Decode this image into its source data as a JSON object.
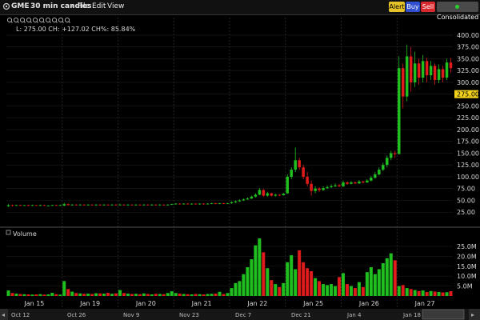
{
  "toolbar": {
    "symbol": "GME",
    "interval": "30 min candles",
    "menu_items": [
      "File",
      "Edit",
      "View"
    ],
    "buttons": {
      "alert": {
        "label": "Alert",
        "color": "#e6c229"
      },
      "buy": {
        "label": "Buy",
        "color": "#2f4fd0"
      },
      "sell": {
        "label": "Sell",
        "color": "#d9292e"
      },
      "consolidated": {
        "label": "Consolidated",
        "color": "#4a4a4a"
      }
    }
  },
  "price_panel": {
    "readout": "L: 275.00  CH: +127.02  CH%: 85.84%",
    "y_ticks": [
      "400.00",
      "375.00",
      "350.00",
      "325.00",
      "300.00",
      "275.00",
      "250.00",
      "225.00",
      "200.00",
      "175.00",
      "150.00",
      "125.00",
      "100.00",
      "75.00",
      "50.00",
      "25.00"
    ],
    "last_price_label": "275.00",
    "last_price_color": "#f2d21b"
  },
  "volume_panel": {
    "title": "Volume",
    "y_ticks": [
      "25.0M",
      "20.0M",
      "15.0M",
      "10.0M",
      "5.0M"
    ]
  },
  "x_axis": {
    "labels": [
      "Jan 15",
      "Jan 19",
      "Jan 20",
      "Jan 21",
      "Jan 22",
      "Jan 25",
      "Jan 26",
      "Jan 27"
    ]
  },
  "overview_axis": {
    "labels": [
      "Oct 12",
      "Oct 26",
      "Nov 9",
      "Nov 23",
      "Dec 7",
      "Dec 21",
      "Jan 4",
      "Jan 18"
    ]
  },
  "colors": {
    "up": "#1fbf1f",
    "down": "#e01b1b",
    "grid": "#2e2e2e",
    "background": "#000000"
  },
  "chart_data": {
    "type": "candlestick",
    "ylim": [
      0,
      410
    ],
    "volume_ylim": [
      0,
      29
    ],
    "days": [
      {
        "label": "Jan 15",
        "candles": [
          [
            38,
            40,
            42,
            36,
            2.8
          ],
          [
            40,
            39,
            41,
            37,
            1.5
          ],
          [
            39,
            40,
            41,
            38,
            1.2
          ],
          [
            40,
            39,
            41,
            38,
            1.0
          ],
          [
            39,
            40,
            40,
            38,
            0.9
          ],
          [
            40,
            39,
            41,
            38,
            0.8
          ],
          [
            39,
            40,
            41,
            38,
            0.7
          ],
          [
            40,
            39,
            40,
            38,
            0.8
          ],
          [
            39,
            40,
            41,
            38,
            0.9
          ],
          [
            40,
            39,
            41,
            38,
            0.7
          ],
          [
            39,
            39,
            40,
            38,
            0.8
          ],
          [
            39,
            40,
            41,
            38,
            1.6
          ],
          [
            40,
            39,
            41,
            38,
            0.9
          ],
          [
            39,
            40,
            41,
            38,
            0.7
          ]
        ]
      },
      {
        "label": "Jan 19",
        "candles": [
          [
            39,
            42,
            45,
            38,
            7.5
          ],
          [
            42,
            40,
            43,
            39,
            3.5
          ],
          [
            40,
            41,
            42,
            39,
            2.2
          ],
          [
            41,
            40,
            42,
            39,
            1.5
          ],
          [
            40,
            41,
            42,
            39,
            1.3
          ],
          [
            41,
            40,
            42,
            39,
            1.1
          ],
          [
            40,
            41,
            42,
            39,
            1.2
          ],
          [
            41,
            40,
            42,
            39,
            1.0
          ],
          [
            40,
            41,
            42,
            39,
            1.4
          ],
          [
            41,
            40,
            42,
            39,
            1.3
          ],
          [
            40,
            41,
            42,
            39,
            1.2
          ],
          [
            41,
            40,
            42,
            39,
            1.6
          ],
          [
            40,
            41,
            42,
            39,
            1.1
          ],
          [
            41,
            40,
            42,
            39,
            1.3
          ]
        ]
      },
      {
        "label": "Jan 20",
        "candles": [
          [
            40,
            41,
            43,
            39,
            3.0
          ],
          [
            41,
            40,
            42,
            39,
            1.5
          ],
          [
            40,
            41,
            42,
            39,
            1.2
          ],
          [
            41,
            40,
            42,
            39,
            1.0
          ],
          [
            40,
            41,
            42,
            39,
            1.1
          ],
          [
            41,
            40,
            42,
            39,
            0.9
          ],
          [
            40,
            41,
            42,
            39,
            1.3
          ],
          [
            41,
            40,
            42,
            39,
            1.0
          ],
          [
            40,
            41,
            42,
            39,
            0.8
          ],
          [
            41,
            40,
            42,
            39,
            1.1
          ],
          [
            40,
            41,
            42,
            39,
            1.0
          ],
          [
            41,
            40,
            42,
            39,
            0.9
          ],
          [
            40,
            41,
            42,
            39,
            1.5
          ],
          [
            41,
            42,
            43,
            40,
            2.4
          ]
        ]
      },
      {
        "label": "Jan 21",
        "candles": [
          [
            42,
            43,
            44,
            41,
            1.5
          ],
          [
            43,
            42,
            44,
            41,
            1.2
          ],
          [
            42,
            43,
            44,
            41,
            1.0
          ],
          [
            43,
            42,
            44,
            41,
            0.9
          ],
          [
            42,
            43,
            44,
            41,
            0.8
          ],
          [
            43,
            42,
            44,
            41,
            1.0
          ],
          [
            42,
            43,
            44,
            41,
            0.9
          ],
          [
            43,
            42,
            44,
            41,
            0.8
          ],
          [
            42,
            43,
            44,
            41,
            1.0
          ],
          [
            43,
            44,
            45,
            42,
            1.1
          ],
          [
            44,
            43,
            45,
            42,
            1.2
          ],
          [
            43,
            44,
            45,
            42,
            2.1
          ],
          [
            44,
            43,
            45,
            42,
            1.0
          ],
          [
            43,
            44,
            45,
            42,
            1.5
          ]
        ]
      },
      {
        "label": "Jan 22",
        "candles": [
          [
            44,
            46,
            48,
            43,
            4.0
          ],
          [
            46,
            48,
            50,
            45,
            6.5
          ],
          [
            48,
            50,
            52,
            47,
            7.5
          ],
          [
            50,
            52,
            54,
            49,
            11.0
          ],
          [
            52,
            54,
            56,
            51,
            14.5
          ],
          [
            54,
            58,
            60,
            53,
            18.5
          ],
          [
            58,
            62,
            65,
            56,
            25.5
          ],
          [
            62,
            72,
            76,
            61,
            29.0
          ],
          [
            72,
            60,
            74,
            58,
            22.0
          ],
          [
            60,
            65,
            68,
            58,
            14.0
          ],
          [
            65,
            60,
            66,
            58,
            8.0
          ],
          [
            60,
            62,
            64,
            58,
            6.0
          ],
          [
            62,
            61,
            63,
            59,
            4.5
          ],
          [
            61,
            64,
            66,
            60,
            6.5
          ]
        ]
      },
      {
        "label": "Jan 25",
        "candles": [
          [
            65,
            100,
            105,
            64,
            17.0
          ],
          [
            100,
            115,
            120,
            95,
            20.5
          ],
          [
            115,
            135,
            162,
            110,
            13.5
          ],
          [
            135,
            120,
            140,
            115,
            23.0
          ],
          [
            120,
            100,
            125,
            95,
            17.0
          ],
          [
            100,
            85,
            110,
            80,
            14.0
          ],
          [
            85,
            70,
            92,
            60,
            12.5
          ],
          [
            70,
            75,
            80,
            65,
            9.0
          ],
          [
            75,
            72,
            78,
            68,
            7.5
          ],
          [
            72,
            76,
            80,
            70,
            6.0
          ],
          [
            76,
            78,
            82,
            74,
            5.5
          ],
          [
            78,
            80,
            84,
            76,
            6.0
          ],
          [
            80,
            82,
            86,
            78,
            5.0
          ],
          [
            82,
            80,
            85,
            78,
            9.5
          ]
        ]
      },
      {
        "label": "Jan 26",
        "candles": [
          [
            80,
            88,
            92,
            78,
            11.5
          ],
          [
            88,
            85,
            90,
            83,
            6.0
          ],
          [
            85,
            88,
            91,
            84,
            5.0
          ],
          [
            88,
            86,
            90,
            84,
            4.0
          ],
          [
            86,
            90,
            93,
            85,
            7.0
          ],
          [
            90,
            88,
            92,
            86,
            4.5
          ],
          [
            88,
            92,
            95,
            87,
            12.0
          ],
          [
            92,
            98,
            102,
            90,
            14.5
          ],
          [
            98,
            105,
            110,
            96,
            11.0
          ],
          [
            105,
            115,
            120,
            103,
            13.5
          ],
          [
            115,
            125,
            130,
            112,
            16.5
          ],
          [
            125,
            140,
            145,
            120,
            19.0
          ],
          [
            140,
            150,
            155,
            135,
            21.5
          ],
          [
            150,
            148,
            155,
            140,
            18.0
          ]
        ]
      },
      {
        "label": "Jan 27",
        "candles": [
          [
            148,
            330,
            355,
            250,
            5.0
          ],
          [
            330,
            270,
            340,
            245,
            5.5
          ],
          [
            270,
            355,
            380,
            260,
            4.0
          ],
          [
            355,
            300,
            375,
            280,
            3.5
          ],
          [
            300,
            340,
            365,
            290,
            3.0
          ],
          [
            340,
            310,
            350,
            295,
            2.5
          ],
          [
            310,
            345,
            358,
            300,
            2.8
          ],
          [
            345,
            315,
            352,
            300,
            2.0
          ],
          [
            315,
            335,
            345,
            305,
            2.5
          ],
          [
            335,
            305,
            340,
            295,
            2.2
          ],
          [
            305,
            328,
            338,
            298,
            2.0
          ],
          [
            328,
            310,
            335,
            300,
            1.8
          ],
          [
            310,
            342,
            350,
            305,
            1.9
          ],
          [
            342,
            330,
            352,
            320,
            2.4
          ]
        ]
      }
    ]
  }
}
